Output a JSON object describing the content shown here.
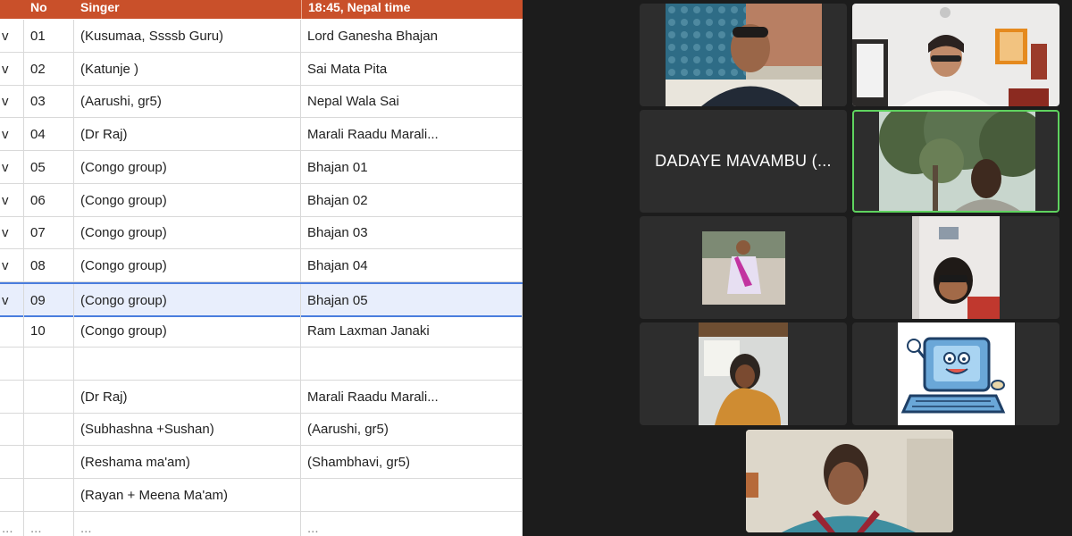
{
  "sheet": {
    "headers": {
      "no": "No",
      "singer": "Singer",
      "time": "18:45, Nepal time"
    },
    "rows": [
      {
        "mark": "v",
        "no": "01",
        "singer": "(Kusumaa, Ssssb Guru)",
        "song": "Lord Ganesha Bhajan"
      },
      {
        "mark": "v",
        "no": "02",
        "singer": "(Katunje )",
        "song": "Sai Mata Pita"
      },
      {
        "mark": "v",
        "no": "03",
        "singer": "(Aarushi, gr5)",
        "song": "Nepal Wala Sai"
      },
      {
        "mark": "v",
        "no": "04",
        "singer": "(Dr Raj)",
        "song": "Marali Raadu Marali..."
      },
      {
        "mark": "v",
        "no": "05",
        "singer": "(Congo group)",
        "song": "Bhajan 01"
      },
      {
        "mark": "v",
        "no": "06",
        "singer": "(Congo group)",
        "song": "Bhajan 02"
      },
      {
        "mark": "v",
        "no": "07",
        "singer": "(Congo group)",
        "song": "Bhajan 03"
      },
      {
        "mark": "v",
        "no": "08",
        "singer": "(Congo group)",
        "song": "Bhajan 04"
      },
      {
        "mark": "v",
        "no": "09",
        "singer": "(Congo group)",
        "song": "Bhajan 05"
      },
      {
        "mark": "",
        "no": "10",
        "singer": "(Congo group)",
        "song": "Ram Laxman Janaki"
      },
      {
        "mark": "",
        "no": "",
        "singer": "",
        "song": ""
      },
      {
        "mark": "",
        "no": "",
        "singer": "(Dr Raj)",
        "song": "Marali Raadu Marali..."
      },
      {
        "mark": "",
        "no": "",
        "singer": "(Subhashna +Sushan)",
        "song": "(Aarushi, gr5)"
      },
      {
        "mark": "",
        "no": "",
        "singer": "(Reshama ma'am)",
        "song": "(Shambhavi, gr5)"
      },
      {
        "mark": "",
        "no": "",
        "singer": "(Rayan + Meena Ma'am)",
        "song": ""
      },
      {
        "mark": "...",
        "no": "...",
        "singer": "...",
        "song": "..."
      }
    ],
    "selected_row": 8
  },
  "meeting": {
    "name_tile": "DADAYE MAVAMBU (...",
    "participants": [
      "participant-1",
      "participant-2",
      "participant-3",
      "participant-4",
      "participant-5",
      "participant-6",
      "participant-7",
      "participant-8"
    ]
  },
  "colors": {
    "header_bg": "#c9502a",
    "grid_bg": "#1c1c1c",
    "tile_bg": "#2d2d2d",
    "active_speaker": "#5fd35f",
    "selection": "#4a7dde"
  }
}
